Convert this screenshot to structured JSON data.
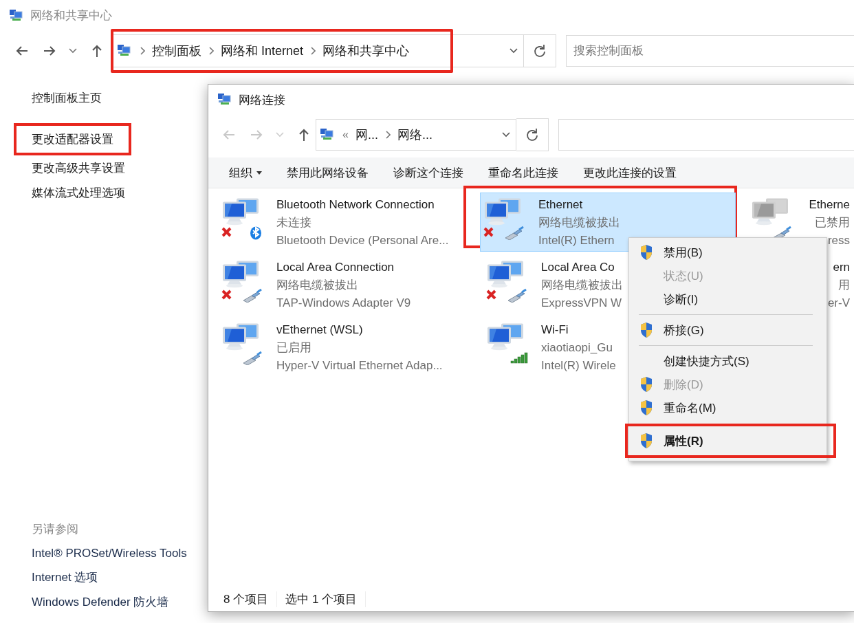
{
  "window": {
    "title": "网络和共享中心"
  },
  "nav": {
    "back": {
      "disabled": false
    },
    "forward": {
      "disabled": false
    }
  },
  "address_bar": {
    "highlighted": true,
    "crumbs": [
      "控制面板",
      "网络和 Internet",
      "网络和共享中心"
    ]
  },
  "search": {
    "placeholder": "搜索控制面板"
  },
  "sidebar": {
    "items": [
      {
        "label": "控制面板主页",
        "highlighted": false
      },
      {
        "label": "更改适配器设置",
        "highlighted": true
      },
      {
        "label": "更改高级共享设置",
        "highlighted": false
      },
      {
        "label": "媒体流式处理选项",
        "highlighted": false
      }
    ],
    "see_also_title": "另请参阅",
    "see_also": [
      "Intel® PROSet/Wireless Tools",
      "Internet 选项",
      "Windows Defender 防火墙"
    ]
  },
  "network_window": {
    "title": "网络连接",
    "nav": {
      "back": {
        "disabled": true
      },
      "forward": {
        "disabled": true
      }
    },
    "address_bar": {
      "prefix": "«",
      "crumbs": [
        "网...",
        "网络..."
      ]
    },
    "commands": [
      {
        "label": "组织",
        "dropdown": true
      },
      {
        "label": "禁用此网络设备",
        "dropdown": false
      },
      {
        "label": "诊断这个连接",
        "dropdown": false
      },
      {
        "label": "重命名此连接",
        "dropdown": false
      },
      {
        "label": "更改此连接的设置",
        "dropdown": false
      }
    ],
    "connections": [
      {
        "name": "Bluetooth Network Connection",
        "status": "未连接",
        "device": "Bluetooth Device (Personal Are...",
        "kind": "bluetooth",
        "disconnected": true,
        "disabled": false,
        "selected": false,
        "highlighted": false,
        "partial": false
      },
      {
        "name": "Ethernet",
        "status": "网络电缆被拔出",
        "device": "Intel(R) Ethern",
        "kind": "cable",
        "disconnected": true,
        "disabled": false,
        "selected": true,
        "highlighted": true,
        "partial": false
      },
      {
        "name": "Etherne",
        "status": "已禁用",
        "device": "ress",
        "kind": "cable",
        "disconnected": false,
        "disabled": true,
        "selected": false,
        "highlighted": false,
        "partial": true
      },
      {
        "name": "Local Area Connection",
        "status": "网络电缆被拔出",
        "device": "TAP-Windows Adapter V9",
        "kind": "cable",
        "disconnected": true,
        "disabled": false,
        "selected": false,
        "highlighted": false,
        "partial": false
      },
      {
        "name": "Local Area Co",
        "status": "网络电缆被拔出",
        "device": "ExpressVPN W",
        "kind": "cable",
        "disconnected": true,
        "disabled": false,
        "selected": false,
        "highlighted": false,
        "partial": false
      },
      {
        "name": "ern",
        "status": "用",
        "device": "er-V",
        "kind": "hidden",
        "selected": false,
        "highlighted": false,
        "partial": true
      },
      {
        "name": "vEthernet (WSL)",
        "status": "已启用",
        "device": "Hyper-V Virtual Ethernet Adap...",
        "kind": "cable",
        "disconnected": false,
        "disabled": false,
        "selected": false,
        "highlighted": false,
        "partial": false
      },
      {
        "name": "Wi-Fi",
        "status": "xiaotiaopi_Gu",
        "device": "Intel(R) Wirele",
        "kind": "wifi",
        "disconnected": false,
        "disabled": false,
        "selected": false,
        "highlighted": false,
        "partial": false
      }
    ],
    "status_bar": [
      "8 个项目",
      "选中 1 个项目"
    ]
  },
  "context_menu": [
    {
      "kind": "item",
      "label": "禁用(B)",
      "shield": true,
      "disabled": false,
      "default": false,
      "highlighted": false
    },
    {
      "kind": "item",
      "label": "状态(U)",
      "shield": false,
      "disabled": true,
      "default": false,
      "highlighted": false
    },
    {
      "kind": "item",
      "label": "诊断(I)",
      "shield": false,
      "disabled": false,
      "default": false,
      "highlighted": false
    },
    {
      "kind": "separator"
    },
    {
      "kind": "item",
      "label": "桥接(G)",
      "shield": true,
      "disabled": false,
      "default": false,
      "highlighted": false
    },
    {
      "kind": "separator"
    },
    {
      "kind": "item",
      "label": "创建快捷方式(S)",
      "shield": false,
      "disabled": false,
      "default": false,
      "highlighted": false
    },
    {
      "kind": "item",
      "label": "删除(D)",
      "shield": true,
      "disabled": true,
      "default": false,
      "highlighted": false
    },
    {
      "kind": "item",
      "label": "重命名(M)",
      "shield": true,
      "disabled": false,
      "default": false,
      "highlighted": false
    },
    {
      "kind": "item",
      "label": "属性(R)",
      "shield": true,
      "disabled": false,
      "default": true,
      "highlighted": true
    }
  ]
}
